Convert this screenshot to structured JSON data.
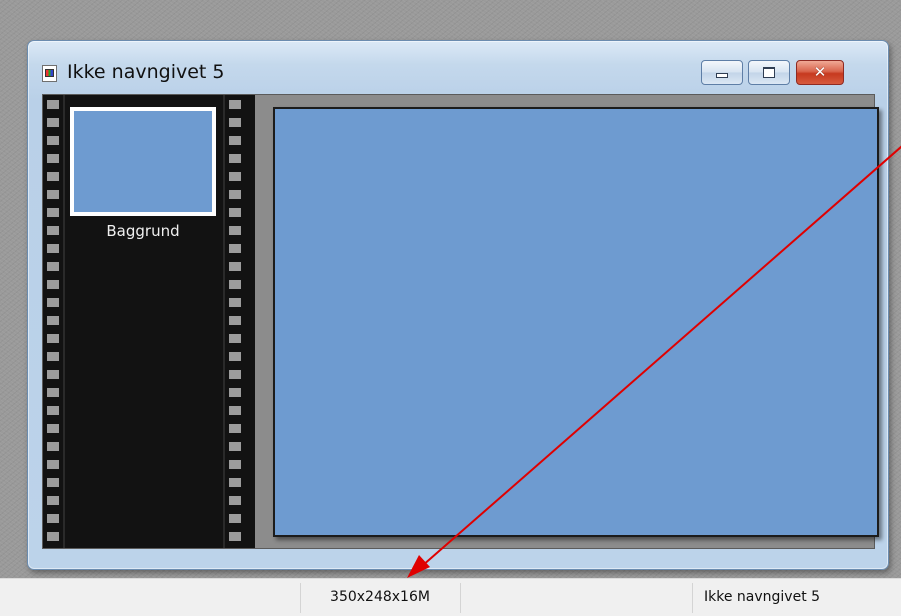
{
  "window": {
    "title": "Ikke navngivet 5",
    "controls": {
      "minimize": "minimize",
      "maximize": "maximize",
      "close": "close"
    }
  },
  "layers": {
    "items": [
      {
        "label": "Baggrund",
        "thumbnail_color": "#6e9bd0"
      }
    ]
  },
  "canvas": {
    "fill_color": "#6e9bd0"
  },
  "status_bar": {
    "image_info": "350x248x16M",
    "document_name": "Ikke navngivet 5"
  },
  "annotation": {
    "type": "arrow",
    "color": "#e00000",
    "points_to": "status_bar.image_info"
  },
  "colors": {
    "workspace": "#9a9a9a",
    "window_frame": "#bcd3ea",
    "filmstrip": "#121212",
    "close_button": "#c6391f"
  }
}
